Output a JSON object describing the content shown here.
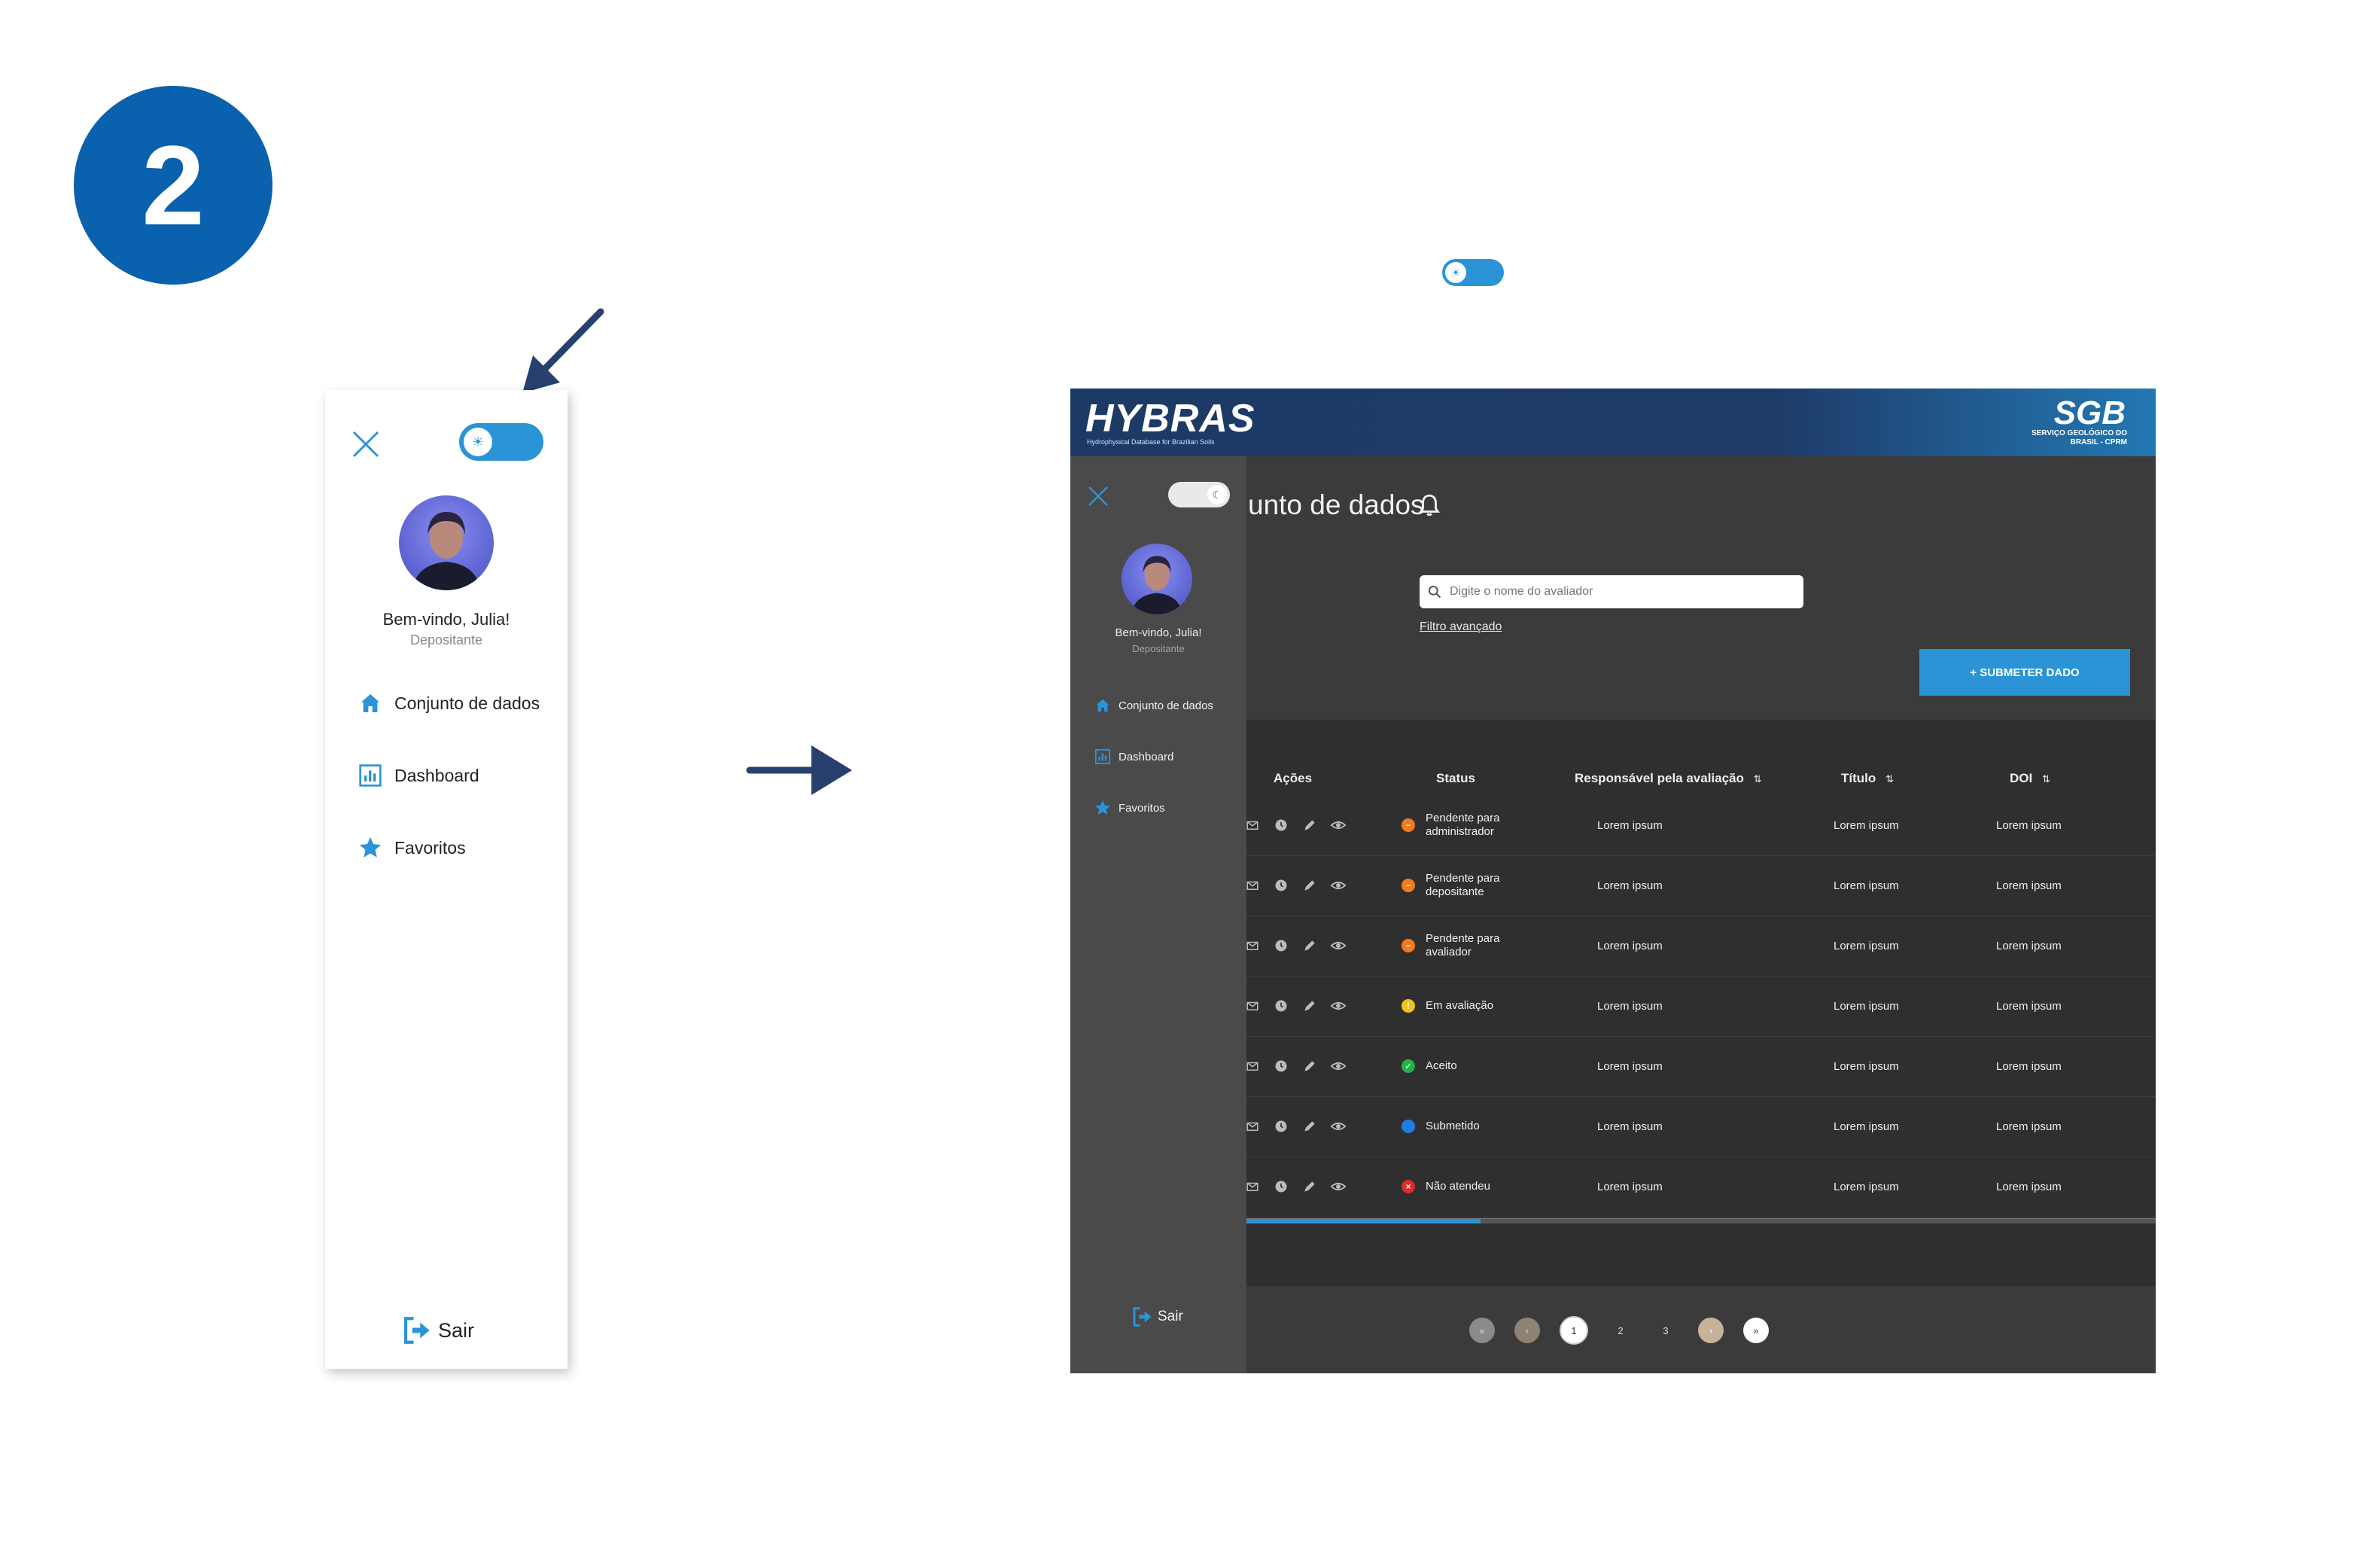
{
  "step": {
    "number": "2"
  },
  "light_sidebar": {
    "theme": "light",
    "welcome": "Bem-vindo, Julia!",
    "role": "Depositante",
    "items": [
      {
        "label": "Conjunto de dados",
        "icon": "home-icon"
      },
      {
        "label": "Dashboard",
        "icon": "chart-icon"
      },
      {
        "label": "Favoritos",
        "icon": "star-icon"
      }
    ],
    "logout": "Sair"
  },
  "dark_screen": {
    "header": {
      "brand": "HYBRAS",
      "brand_sub": "Hydrophysical Database for Brazilian Soils",
      "partner": "SGB",
      "partner_sub": "SERVIÇO GEOLÓGICO DO BRASIL - CPRM"
    },
    "page_title": "unto de dados",
    "search": {
      "placeholder": "Digite o nome do avaliador",
      "advanced_filter": "Filtro avançado"
    },
    "submit_button": "+ SUBMETER DADO",
    "table": {
      "headers": [
        "Ações",
        "Status",
        "Responsável pela avaliação",
        "Título",
        "DOI"
      ],
      "rows": [
        {
          "status": "Pendente para administrador",
          "status_color": "#f47a20",
          "responsavel": "Lorem ipsum",
          "titulo": "Lorem ipsum",
          "doi": "Lorem ipsum"
        },
        {
          "status": "Pendente para depositante",
          "status_color": "#f47a20",
          "responsavel": "Lorem ipsum",
          "titulo": "Lorem ipsum",
          "doi": "Lorem ipsum"
        },
        {
          "status": "Pendente para avaliador",
          "status_color": "#f47a20",
          "responsavel": "Lorem ipsum",
          "titulo": "Lorem ipsum",
          "doi": "Lorem ipsum"
        },
        {
          "status": "Em avaliação",
          "status_color": "#f2c318",
          "responsavel": "Lorem ipsum",
          "titulo": "Lorem ipsum",
          "doi": "Lorem ipsum"
        },
        {
          "status": "Aceito",
          "status_color": "#22b34a",
          "responsavel": "Lorem ipsum",
          "titulo": "Lorem ipsum",
          "doi": "Lorem ipsum"
        },
        {
          "status": "Submetido",
          "status_color": "#1e7de0",
          "responsavel": "Lorem ipsum",
          "titulo": "Lorem ipsum",
          "doi": "Lorem ipsum"
        },
        {
          "status": "Não atendeu",
          "status_color": "#e02b2b",
          "responsavel": "Lorem ipsum",
          "titulo": "Lorem ipsum",
          "doi": "Lorem ipsum"
        }
      ],
      "scroll_fraction": 0.26
    },
    "pagination": {
      "pages": [
        "1",
        "2",
        "3"
      ],
      "current": "1"
    },
    "sidebar": {
      "theme": "dark",
      "welcome": "Bem-vindo, Julia!",
      "role": "Depositante",
      "items": [
        {
          "label": "Conjunto de dados",
          "icon": "home-icon"
        },
        {
          "label": "Dashboard",
          "icon": "chart-icon"
        },
        {
          "label": "Favoritos",
          "icon": "star-icon"
        }
      ],
      "logout": "Sair"
    }
  },
  "colors": {
    "accent": "#2b94d6",
    "badge": "#0a61ad",
    "arrow": "#27406e",
    "dark_bg": "#3b3b3b",
    "dark_sidebar": "#4a4a4a"
  }
}
